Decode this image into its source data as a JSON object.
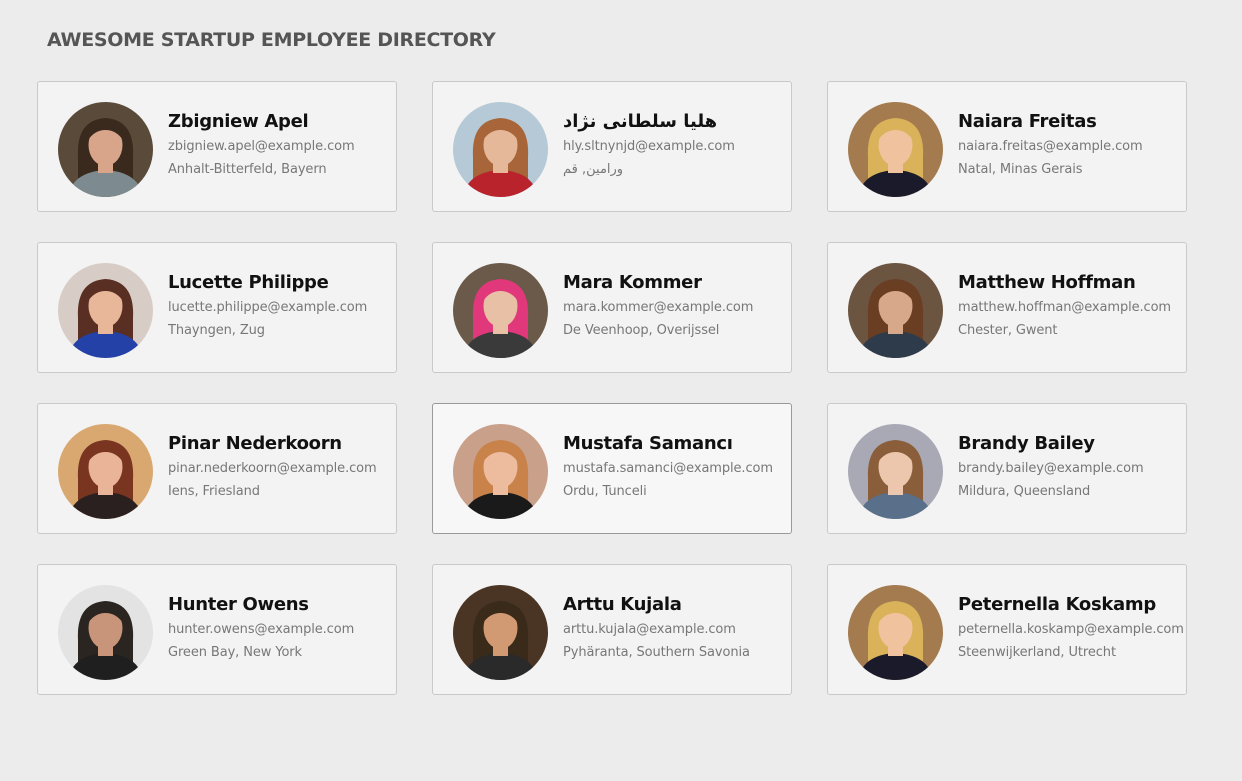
{
  "header": {
    "title": "AWESOME STARTUP EMPLOYEE DIRECTORY"
  },
  "employees": [
    {
      "name": "Zbigniew Apel",
      "email": "zbigniew.apel@example.com",
      "location": "Anhalt-Bitterfeld, Bayern",
      "bg": "#5a4a3a",
      "skin": "#d9a58a",
      "hair": "#3a2a1e",
      "shirt": "#7d8a8f"
    },
    {
      "name": "هليا سلطانی نژاد",
      "email": "hly.sltnynjd@example.com",
      "location": "ورامین, قم",
      "bg": "#b5c9d6",
      "skin": "#e6b89a",
      "hair": "#a8653a",
      "shirt": "#b8232c"
    },
    {
      "name": "Naiara Freitas",
      "email": "naiara.freitas@example.com",
      "location": "Natal, Minas Gerais",
      "bg": "#a37b4f",
      "skin": "#f0c29e",
      "hair": "#d9b25a",
      "shirt": "#1a1a2a"
    },
    {
      "name": "Lucette Philippe",
      "email": "lucette.philippe@example.com",
      "location": "Thayngen, Zug",
      "bg": "#d8ccc6",
      "skin": "#e8b79a",
      "hair": "#5a2f23",
      "shirt": "#2441a8"
    },
    {
      "name": "Mara Kommer",
      "email": "mara.kommer@example.com",
      "location": "De Veenhoop, Overijssel",
      "bg": "#6b5a4a",
      "skin": "#e8c0a5",
      "hair": "#e0387a",
      "shirt": "#3a3a3a"
    },
    {
      "name": "Matthew Hoffman",
      "email": "matthew.hoffman@example.com",
      "location": "Chester, Gwent",
      "bg": "#6b5440",
      "skin": "#d8a88a",
      "hair": "#6a3e22",
      "shirt": "#2e3b4a"
    },
    {
      "name": "Pinar Nederkoorn",
      "email": "pinar.nederkoorn@example.com",
      "location": "Iens, Friesland",
      "bg": "#d9a870",
      "skin": "#e9b497",
      "hair": "#7a3520",
      "shirt": "#2b2020"
    },
    {
      "name": "Mustafa Samancı",
      "email": "mustafa.samanci@example.com",
      "location": "Ordu, Tunceli",
      "bg": "#c9a08a",
      "skin": "#edbb9e",
      "hair": "#c8824a",
      "shirt": "#1a1a1a"
    },
    {
      "name": "Brandy Bailey",
      "email": "brandy.bailey@example.com",
      "location": "Mildura, Queensland",
      "bg": "#a8a9b5",
      "skin": "#ecc7ae",
      "hair": "#8a5e3a",
      "shirt": "#5a6f8a"
    },
    {
      "name": "Hunter Owens",
      "email": "hunter.owens@example.com",
      "location": "Green Bay, New York",
      "bg": "#e3e3e3",
      "skin": "#c9957a",
      "hair": "#2a2520",
      "shirt": "#1f1f1f"
    },
    {
      "name": "Arttu Kujala",
      "email": "arttu.kujala@example.com",
      "location": "Pyhäranta, Southern Savonia",
      "bg": "#4a3525",
      "skin": "#d29a72",
      "hair": "#3a2a1a",
      "shirt": "#2a2a2a"
    },
    {
      "name": "Peternella Koskamp",
      "email": "peternella.koskamp@example.com",
      "location": "Steenwijkerland, Utrecht",
      "bg": "#a37b4f",
      "skin": "#f0c29e",
      "hair": "#d9b25a",
      "shirt": "#1a1a2a"
    }
  ]
}
